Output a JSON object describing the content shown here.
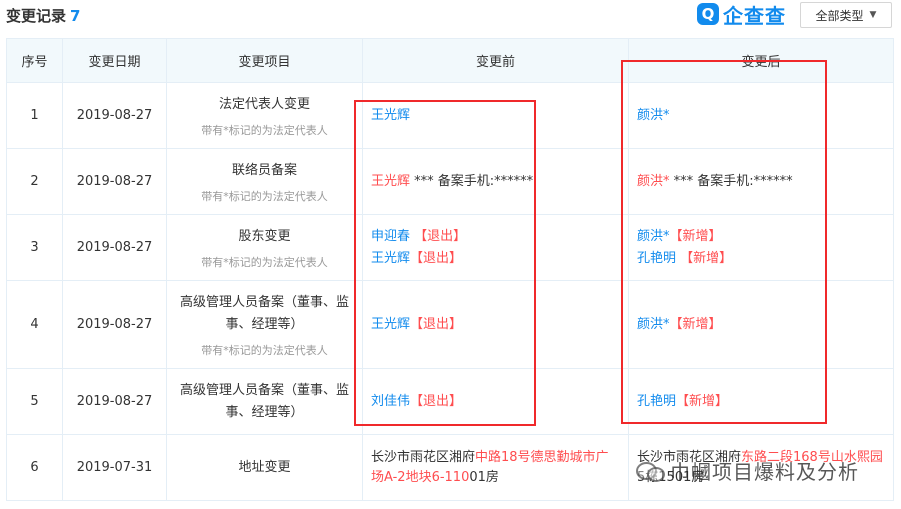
{
  "header": {
    "title": "变更记录",
    "count": "7",
    "brand_mark": "Q",
    "brand_text": "企查查",
    "type_filter": "全部类型",
    "type_filter_icon": "caret-down-icon"
  },
  "table": {
    "columns": [
      "序号",
      "变更日期",
      "变更项目",
      "变更前",
      "变更后"
    ],
    "rows": [
      {
        "no": "1",
        "date": "2019-08-27",
        "item": "法定代表人变更",
        "note": "带有*标记的为法定代表人",
        "before": [
          {
            "name": "王光辉",
            "tag": ""
          }
        ],
        "after": [
          {
            "name": "颜洪*",
            "tag": ""
          }
        ]
      },
      {
        "no": "2",
        "date": "2019-08-27",
        "item": "联络员备案",
        "note": "带有*标记的为法定代表人",
        "before_name": "王光辉",
        "before_rest": " *** 备案手机:******",
        "after_name": "颜洪*",
        "after_rest": " *** 备案手机:******"
      },
      {
        "no": "3",
        "date": "2019-08-27",
        "item": "股东变更",
        "note": "带有*标记的为法定代表人",
        "before": [
          {
            "name": "申迎春",
            "tag": " 【退出】"
          },
          {
            "name": "王光辉",
            "tag": "【退出】"
          }
        ],
        "after": [
          {
            "name": "颜洪*",
            "tag": "【新增】"
          },
          {
            "name": "孔艳明",
            "tag": " 【新增】"
          }
        ]
      },
      {
        "no": "4",
        "date": "2019-08-27",
        "item": "高级管理人员备案（董事、监事、经理等）",
        "note": "带有*标记的为法定代表人",
        "before": [
          {
            "name": "王光辉",
            "tag": "【退出】"
          }
        ],
        "after": [
          {
            "name": "颜洪*",
            "tag": "【新增】"
          }
        ]
      },
      {
        "no": "5",
        "date": "2019-08-27",
        "item": "高级管理人员备案（董事、监事、经理等）",
        "before": [
          {
            "name": "刘佳伟",
            "tag": "【退出】"
          }
        ],
        "after": [
          {
            "name": "孔艳明",
            "tag": "【新增】"
          }
        ]
      },
      {
        "no": "6",
        "date": "2019-07-31",
        "item": "地址变更",
        "before_address": {
          "a": "长沙市雨花区湘府",
          "b": "中路18号德思勤城市广场A-2地块6-110",
          "c": "01房"
        },
        "after_address": {
          "a": "长沙市雨花区湘府",
          "b": "东路二段168号山水熙园",
          "c": "5栋1501房"
        }
      }
    ]
  },
  "watermark": {
    "text": "巾幗项目爆料及分析",
    "icon": "wechat-icon"
  },
  "colors": {
    "accent": "#128bed",
    "highlight_box": "#f0292b",
    "tag_red": "#ff4d4f",
    "header_bg": "#f2f9fc"
  }
}
